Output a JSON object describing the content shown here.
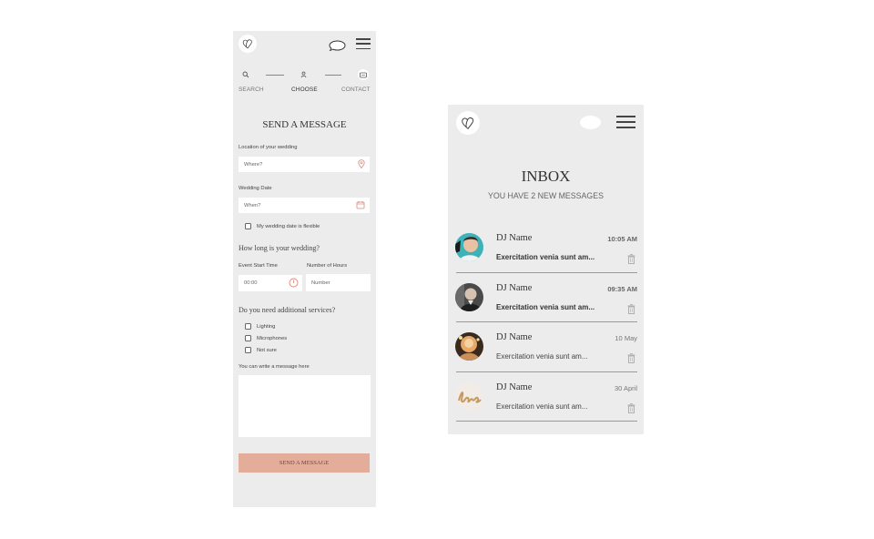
{
  "send_form": {
    "steps": [
      {
        "label": "SEARCH",
        "icon": "search-icon"
      },
      {
        "label": "CHOOSE",
        "icon": "person-icon"
      },
      {
        "label": "CONTACT",
        "icon": "message-icon"
      }
    ],
    "title": "SEND A MESSAGE",
    "location": {
      "label": "Location of your wedding",
      "placeholder": "Where?"
    },
    "date": {
      "label": "Wedding Date",
      "placeholder": "When?"
    },
    "flexible_label": "My wedding date is flexible",
    "duration_question": "How long is your wedding?",
    "start_time": {
      "label": "Event Start Time",
      "value": "00:00"
    },
    "hours": {
      "label": "Number of Hours",
      "placeholder": "Number"
    },
    "services_question": "Do you need additional services?",
    "services": [
      "Lighting",
      "Microphones",
      "Not sure"
    ],
    "message_label": "You can write a message here",
    "submit_label": "SEND A MESSAGE",
    "accent_color": "#e4ad9a"
  },
  "inbox": {
    "title": "INBOX",
    "subtitle": "YOU HAVE 2 NEW MESSAGES",
    "messages": [
      {
        "name": "DJ Name",
        "time": "10:05 AM",
        "preview": "Exercitation venia sunt am...",
        "unread": true
      },
      {
        "name": "DJ Name",
        "time": "09:35 AM",
        "preview": "Exercitation venia sunt am...",
        "unread": true
      },
      {
        "name": "DJ Name",
        "time": "10 May",
        "preview": "Exercitation venia sunt am...",
        "unread": false
      },
      {
        "name": "DJ Name",
        "time": "30 April",
        "preview": "Exercitation venia sunt am...",
        "unread": false
      }
    ]
  }
}
